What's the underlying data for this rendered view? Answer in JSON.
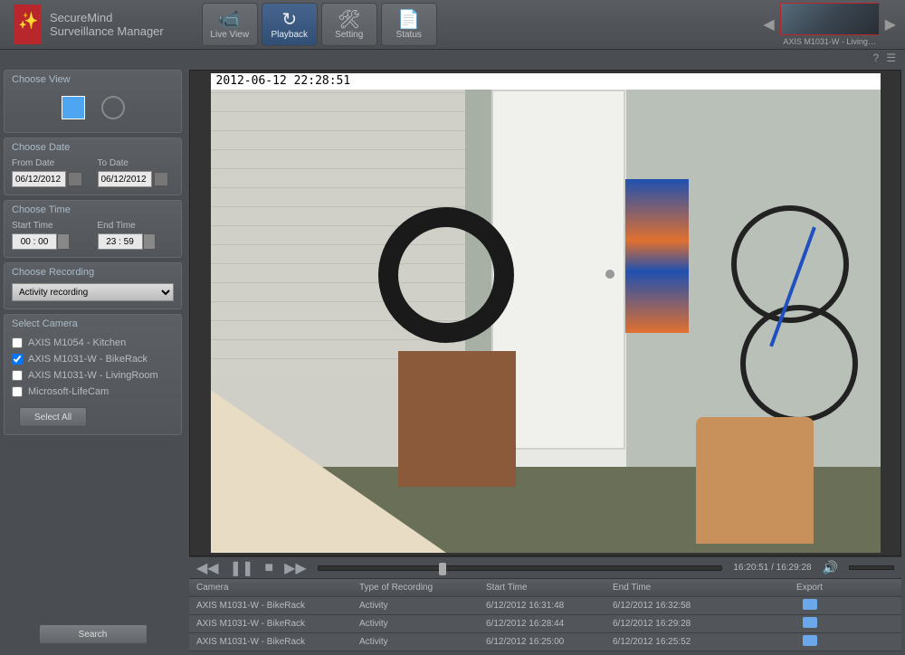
{
  "app": {
    "title1": "SecureMind",
    "title2": "Surveillance Manager"
  },
  "nav": {
    "liveView": "Live View",
    "playback": "Playback",
    "setting": "Setting",
    "status": "Status"
  },
  "thumb": {
    "label": "AXIS M1031-W - Living…"
  },
  "side": {
    "chooseView": "Choose View",
    "chooseDate": "Choose Date",
    "fromDate": "From Date",
    "toDate": "To Date",
    "fromDateVal": "06/12/2012",
    "toDateVal": "06/12/2012",
    "chooseTime": "Choose Time",
    "startTime": "Start Time",
    "endTime": "End Time",
    "startTimeVal": "00 : 00",
    "endTimeVal": "23 : 59",
    "chooseRecording": "Choose Recording",
    "recordingType": "Activity recording",
    "selectCamera": "Select Camera",
    "cameras": [
      {
        "label": "AXIS M1054 - Kitchen",
        "checked": false
      },
      {
        "label": "AXIS M1031-W - BikeRack",
        "checked": true
      },
      {
        "label": "AXIS M1031-W - LivingRoom",
        "checked": false
      },
      {
        "label": "Microsoft-LifeCam",
        "checked": false
      }
    ],
    "selectAll": "Select All",
    "search": "Search"
  },
  "video": {
    "timestamp": "2012-06-12 22:28:51",
    "time": "16:20:51 / 16:29:28"
  },
  "table": {
    "headers": {
      "camera": "Camera",
      "type": "Type of Recording",
      "start": "Start Time",
      "end": "End Time",
      "export": "Export"
    },
    "rows": [
      {
        "camera": "AXIS M1031-W - BikeRack",
        "type": "Activity",
        "start": "6/12/2012 16:31:48",
        "end": "6/12/2012 16:32:58"
      },
      {
        "camera": "AXIS M1031-W - BikeRack",
        "type": "Activity",
        "start": "6/12/2012 16:28:44",
        "end": "6/12/2012 16:29:28"
      },
      {
        "camera": "AXIS M1031-W - BikeRack",
        "type": "Activity",
        "start": "6/12/2012 16:25:00",
        "end": "6/12/2012 16:25:52"
      }
    ]
  }
}
